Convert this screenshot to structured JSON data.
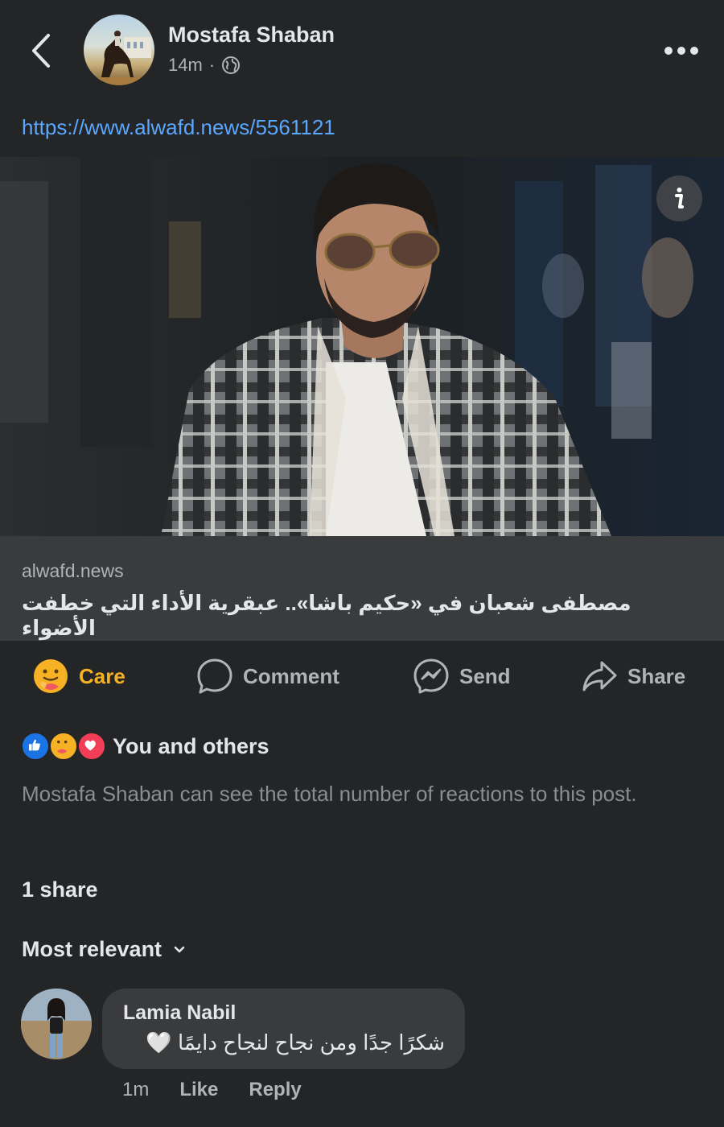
{
  "header": {
    "poster_name": "Mostafa Shaban",
    "post_time": "14m",
    "separator": "·",
    "audience_icon": "globe-icon",
    "back_icon": "chevron-left-icon",
    "more_icon": "more-dots-icon"
  },
  "post": {
    "link_url": "https://www.alwafd.news/5561121",
    "preview": {
      "domain": "alwafd.news",
      "title": "مصطفى شعبان في «حكيم باشا».. عبقرية الأداء التي خطفت الأضواء",
      "info_icon": "info-icon"
    }
  },
  "actions": {
    "care": "Care",
    "comment": "Comment",
    "send": "Send",
    "share": "Share"
  },
  "reactions": {
    "summary_text": "You and others",
    "icons": [
      "like-icon",
      "care-icon",
      "love-icon"
    ],
    "note": "Mostafa Shaban can see the total number of reactions to this post."
  },
  "shares": "1 share",
  "sort_label": "Most relevant",
  "comments": [
    {
      "author": "Lamia Nabil",
      "text": "شكرًا جدًا ومن نجاح لنجاح دايمًا 🤍",
      "time": "1m",
      "like_label": "Like",
      "reply_label": "Reply"
    }
  ],
  "colors": {
    "background": "#242526",
    "surface": "#3a3b3c",
    "link": "#5aa7ff",
    "care_active": "#f7b125",
    "secondary_text": "#b0b3b8"
  }
}
